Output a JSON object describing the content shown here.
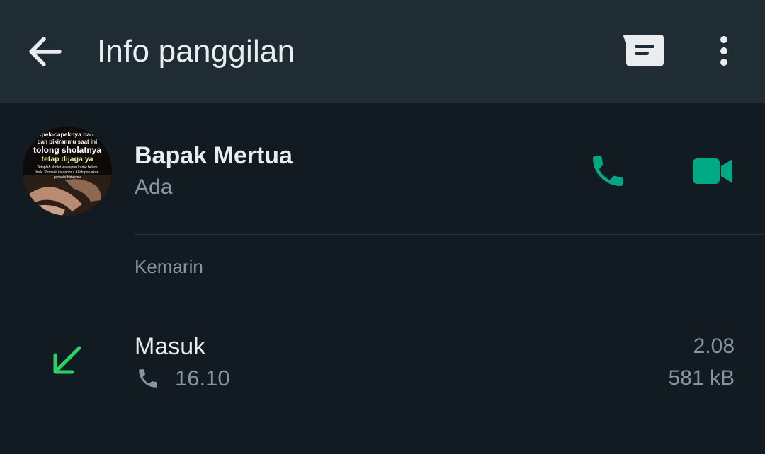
{
  "appbar": {
    "title": "Info panggilan",
    "icons": {
      "back": "back-arrow-icon",
      "message": "message-icon",
      "menu": "more-vert-icon"
    }
  },
  "contact": {
    "name": "Bapak Mertua",
    "status": "Ada",
    "avatar_text": {
      "line1": "Capek-capeknya badan",
      "line2": "dan pikiranmu saat ini",
      "line3": "tolong sholatnya",
      "line4": "tetap dijaga ya",
      "line5": "Tetaplah sholat walaupun kamu belum",
      "line6": "baik. Perbaiki ibadahmu, Allah pun akan",
      "line7": "perbaiki hidupmu"
    }
  },
  "actions": {
    "voice_call_icon": "phone-icon",
    "video_call_icon": "videocam-icon"
  },
  "colors": {
    "accent": "#00a884",
    "incoming": "#25d366",
    "background": "#121b22",
    "appbar": "#1f2c34"
  },
  "log": {
    "date": "Kemarin",
    "entries": [
      {
        "type": "Masuk",
        "time": "16.10",
        "duration": "2.08",
        "size": "581 kB",
        "direction_icon": "incoming-arrow-icon",
        "call_icon": "phone-icon"
      }
    ]
  }
}
